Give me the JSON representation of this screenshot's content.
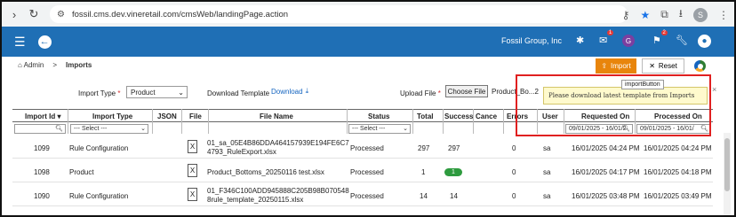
{
  "browser": {
    "url": "fossil.cms.dev.vineretail.com/cmsWeb/landingPage.action",
    "profile_letter": "S"
  },
  "header": {
    "company": "Fossil Group, Inc",
    "bell_badge": "1",
    "flag_badge": "2",
    "avatar_letter": "G",
    "brand_color": "#1f6fb5"
  },
  "breadcrumb": {
    "home": "Admin",
    "separator": ">",
    "current": "Imports"
  },
  "toolbar": {
    "import_label": "Import",
    "reset_label": "Reset",
    "import_color": "#e8850c"
  },
  "tooltip": {
    "button_name": "importButton",
    "message": "Please download latest template from Imports"
  },
  "form": {
    "import_type_label": "Import Type",
    "import_type_value": "Product",
    "download_template_label": "Download Template",
    "download_link": "Download",
    "upload_file_label": "Upload File",
    "choose_file_button": "Choose File",
    "chosen_file": "Product_Bo...2"
  },
  "table": {
    "headers": [
      "Import Id",
      "Import Type",
      "JSON",
      "File",
      "File Name",
      "Status",
      "Total",
      "Success",
      "Cance",
      "Errors",
      "User",
      "Requested On",
      "Processed On"
    ],
    "filters": {
      "type_select": "--- Select ---",
      "status_select": "--- Select ---",
      "requested_range": "09/01/2025 - 16/01/2",
      "processed_range": "09/01/2025 - 16/01/"
    },
    "rows": [
      {
        "id": "1099",
        "type": "Rule Configuration",
        "file_line1": "01_sa_05E4B86DDA464157939E194FE6C7",
        "file_line2": "4793_RuleExport.xlsx",
        "status": "Processed",
        "total": "297",
        "success": "297",
        "errors": "0",
        "user": "sa",
        "requested": "16/01/2025 04:24 PM",
        "processed": "16/01/2025 04:24 PM"
      },
      {
        "id": "1098",
        "type": "Product",
        "file_line1": "Product_Bottoms_20250116 test.xlsx",
        "file_line2": "",
        "status": "Processed",
        "total": "1",
        "success": "1",
        "errors": "0",
        "user": "sa",
        "requested": "16/01/2025 04:17 PM",
        "processed": "16/01/2025 04:18 PM"
      },
      {
        "id": "1090",
        "type": "Rule Configuration",
        "file_line1": "01_F346C100ADD945888C205B98B070548",
        "file_line2": "8rule_template_20250115.xlsx",
        "status": "Processed",
        "total": "14",
        "success": "14",
        "errors": "0",
        "user": "sa",
        "requested": "16/01/2025 03:48 PM",
        "processed": "16/01/2025 03:49 PM"
      }
    ]
  }
}
